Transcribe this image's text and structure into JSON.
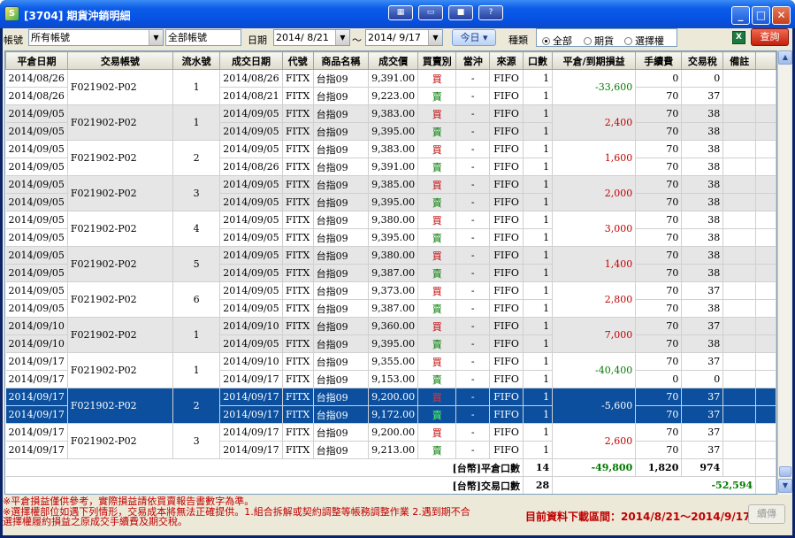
{
  "window": {
    "app_icon": "S",
    "title": "[3704] 期貨沖銷明細",
    "toolbar_icons": [
      "layout-icon",
      "window-icon",
      "camera-icon",
      "help-icon"
    ],
    "controls": {
      "minimize": "_",
      "maximize": "□",
      "close": "✕"
    }
  },
  "filters": {
    "account_label": "帳號",
    "account_value": "所有帳號",
    "account_name": "全部帳號",
    "date_label": "日期",
    "date_from": "2014/ 8/21",
    "date_sep": "～",
    "date_to": "2014/ 9/17",
    "today_button": "今日",
    "kind_label": "種類",
    "kind_options": [
      "全部",
      "期貨",
      "選擇權"
    ],
    "kind_selected": "全部",
    "excel_icon": "X",
    "query_button": "查詢"
  },
  "table": {
    "headers": [
      "平倉日期",
      "交易帳號",
      "流水號",
      "成交日期",
      "代號",
      "商品名稱",
      "成交價",
      "買賣別",
      "當沖",
      "來源",
      "口數",
      "平倉/到期損益",
      "手續費",
      "交易稅",
      "備註"
    ],
    "groups": [
      {
        "close_dates": [
          "2014/08/26",
          "2014/08/26"
        ],
        "account": "F021902-P02",
        "serial": "1",
        "rows": [
          [
            "2014/08/26",
            "FITX",
            "台指09",
            "9,391.00",
            "買",
            "-",
            "FIFO",
            "1",
            "0",
            "0"
          ],
          [
            "2014/08/21",
            "FITX",
            "台指09",
            "9,223.00",
            "賣",
            "-",
            "FIFO",
            "1",
            "70",
            "37"
          ]
        ],
        "pnl": "-33,600",
        "shade": false
      },
      {
        "close_dates": [
          "2014/09/05",
          "2014/09/05"
        ],
        "account": "F021902-P02",
        "serial": "1",
        "rows": [
          [
            "2014/09/05",
            "FITX",
            "台指09",
            "9,383.00",
            "買",
            "-",
            "FIFO",
            "1",
            "70",
            "38"
          ],
          [
            "2014/09/05",
            "FITX",
            "台指09",
            "9,395.00",
            "賣",
            "-",
            "FIFO",
            "1",
            "70",
            "38"
          ]
        ],
        "pnl": "2,400",
        "shade": true
      },
      {
        "close_dates": [
          "2014/09/05",
          "2014/09/05"
        ],
        "account": "F021902-P02",
        "serial": "2",
        "rows": [
          [
            "2014/09/05",
            "FITX",
            "台指09",
            "9,383.00",
            "買",
            "-",
            "FIFO",
            "1",
            "70",
            "38"
          ],
          [
            "2014/08/26",
            "FITX",
            "台指09",
            "9,391.00",
            "賣",
            "-",
            "FIFO",
            "1",
            "70",
            "38"
          ]
        ],
        "pnl": "1,600",
        "shade": false
      },
      {
        "close_dates": [
          "2014/09/05",
          "2014/09/05"
        ],
        "account": "F021902-P02",
        "serial": "3",
        "rows": [
          [
            "2014/09/05",
            "FITX",
            "台指09",
            "9,385.00",
            "買",
            "-",
            "FIFO",
            "1",
            "70",
            "38"
          ],
          [
            "2014/09/05",
            "FITX",
            "台指09",
            "9,395.00",
            "賣",
            "-",
            "FIFO",
            "1",
            "70",
            "38"
          ]
        ],
        "pnl": "2,000",
        "shade": true
      },
      {
        "close_dates": [
          "2014/09/05",
          "2014/09/05"
        ],
        "account": "F021902-P02",
        "serial": "4",
        "rows": [
          [
            "2014/09/05",
            "FITX",
            "台指09",
            "9,380.00",
            "買",
            "-",
            "FIFO",
            "1",
            "70",
            "38"
          ],
          [
            "2014/09/05",
            "FITX",
            "台指09",
            "9,395.00",
            "賣",
            "-",
            "FIFO",
            "1",
            "70",
            "38"
          ]
        ],
        "pnl": "3,000",
        "shade": false
      },
      {
        "close_dates": [
          "2014/09/05",
          "2014/09/05"
        ],
        "account": "F021902-P02",
        "serial": "5",
        "rows": [
          [
            "2014/09/05",
            "FITX",
            "台指09",
            "9,380.00",
            "買",
            "-",
            "FIFO",
            "1",
            "70",
            "38"
          ],
          [
            "2014/09/05",
            "FITX",
            "台指09",
            "9,387.00",
            "賣",
            "-",
            "FIFO",
            "1",
            "70",
            "38"
          ]
        ],
        "pnl": "1,400",
        "shade": true
      },
      {
        "close_dates": [
          "2014/09/05",
          "2014/09/05"
        ],
        "account": "F021902-P02",
        "serial": "6",
        "rows": [
          [
            "2014/09/05",
            "FITX",
            "台指09",
            "9,373.00",
            "買",
            "-",
            "FIFO",
            "1",
            "70",
            "37"
          ],
          [
            "2014/09/05",
            "FITX",
            "台指09",
            "9,387.00",
            "賣",
            "-",
            "FIFO",
            "1",
            "70",
            "38"
          ]
        ],
        "pnl": "2,800",
        "shade": false
      },
      {
        "close_dates": [
          "2014/09/10",
          "2014/09/10"
        ],
        "account": "F021902-P02",
        "serial": "1",
        "rows": [
          [
            "2014/09/10",
            "FITX",
            "台指09",
            "9,360.00",
            "買",
            "-",
            "FIFO",
            "1",
            "70",
            "37"
          ],
          [
            "2014/09/05",
            "FITX",
            "台指09",
            "9,395.00",
            "賣",
            "-",
            "FIFO",
            "1",
            "70",
            "38"
          ]
        ],
        "pnl": "7,000",
        "shade": true
      },
      {
        "close_dates": [
          "2014/09/17",
          "2014/09/17"
        ],
        "account": "F021902-P02",
        "serial": "1",
        "rows": [
          [
            "2014/09/10",
            "FITX",
            "台指09",
            "9,355.00",
            "買",
            "-",
            "FIFO",
            "1",
            "70",
            "37"
          ],
          [
            "2014/09/17",
            "FITX",
            "台指09",
            "9,153.00",
            "賣",
            "-",
            "FIFO",
            "1",
            "0",
            "0"
          ]
        ],
        "pnl": "-40,400",
        "shade": false
      },
      {
        "close_dates": [
          "2014/09/17",
          "2014/09/17"
        ],
        "account": "F021902-P02",
        "serial": "2",
        "rows": [
          [
            "2014/09/17",
            "FITX",
            "台指09",
            "9,200.00",
            "買",
            "-",
            "FIFO",
            "1",
            "70",
            "37"
          ],
          [
            "2014/09/17",
            "FITX",
            "台指09",
            "9,172.00",
            "賣",
            "-",
            "FIFO",
            "1",
            "70",
            "37"
          ]
        ],
        "pnl": "-5,600",
        "shade": false,
        "selected": true
      },
      {
        "close_dates": [
          "2014/09/17",
          "2014/09/17"
        ],
        "account": "F021902-P02",
        "serial": "3",
        "rows": [
          [
            "2014/09/17",
            "FITX",
            "台指09",
            "9,200.00",
            "買",
            "-",
            "FIFO",
            "1",
            "70",
            "37"
          ],
          [
            "2014/09/17",
            "FITX",
            "台指09",
            "9,213.00",
            "賣",
            "-",
            "FIFO",
            "1",
            "70",
            "37"
          ]
        ],
        "pnl": "2,600",
        "shade": false
      }
    ],
    "summary": [
      {
        "label": "[台幣]平倉口數",
        "qty": "14",
        "pnl": "-49,800",
        "fee": "1,820",
        "tax": "974"
      },
      {
        "label": "[台幣]交易口數",
        "qty": "28",
        "net": "-52,594"
      }
    ]
  },
  "footer": {
    "notes": [
      "※平倉損益僅供參考，實際損益請依買賣報告書數字為準。",
      "※選擇權部位如遇下列情形，交易成本將無法正確提供。1.組合拆解或契約調整等帳務調整作業 2.遇到期不合",
      "選擇權履約損益之原成交手續費及期交稅。"
    ],
    "range_text": "目前資料下載區間：2014/8/21～2014/9/17",
    "refresh_button": "續傳"
  },
  "colors": {
    "titlebar": "#0551e4",
    "buy": "#c00000",
    "sell": "#007a00",
    "selected_row": "#0b4f9e",
    "note": "#c00000"
  }
}
